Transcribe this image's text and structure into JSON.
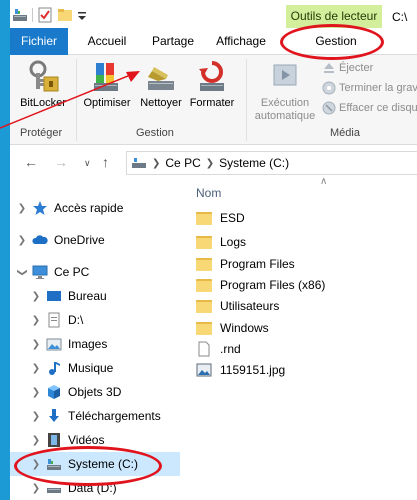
{
  "titlebar": {
    "contextual_tab": "Outils de lecteur",
    "title": "C:\\"
  },
  "tabs": {
    "fichier": "Fichier",
    "accueil": "Accueil",
    "partage": "Partage",
    "affichage": "Affichage",
    "gestion": "Gestion"
  },
  "ribbon": {
    "bitlocker": "BitLocker",
    "proteger": "Protéger",
    "optimiser": "Optimiser",
    "nettoyer": "Nettoyer",
    "formater": "Formater",
    "gestion_group": "Gestion",
    "execution_line1": "Exécution",
    "execution_line2": "automatique",
    "ejecter": "Éjecter",
    "terminer": "Terminer la gravure",
    "effacer": "Effacer ce disque",
    "media": "Média"
  },
  "address": {
    "pc": "Ce PC",
    "drive": "Systeme (C:)"
  },
  "nav": [
    {
      "label": "Accès rapide"
    },
    {
      "label": "OneDrive"
    },
    {
      "label": "Ce PC"
    },
    {
      "label": "Bureau"
    },
    {
      "label": "D:\\"
    },
    {
      "label": "Images"
    },
    {
      "label": "Musique"
    },
    {
      "label": "Objets 3D"
    },
    {
      "label": "Téléchargements"
    },
    {
      "label": "Vidéos"
    },
    {
      "label": "Systeme (C:)"
    },
    {
      "label": "Data (D:)"
    }
  ],
  "files": {
    "column": "Nom",
    "items": [
      {
        "name": "ESD"
      },
      {
        "name": "Logs"
      },
      {
        "name": "Program Files"
      },
      {
        "name": "Program Files (x86)"
      },
      {
        "name": "Utilisateurs"
      },
      {
        "name": "Windows"
      },
      {
        "name": ".rnd"
      },
      {
        "name": "1159151.jpg"
      }
    ]
  },
  "colors": {
    "accent": "#1979ca",
    "contextual": "#d3ef9c",
    "annotation": "#e0141c",
    "selection": "#cce8ff",
    "background": "#1b9ad6"
  }
}
